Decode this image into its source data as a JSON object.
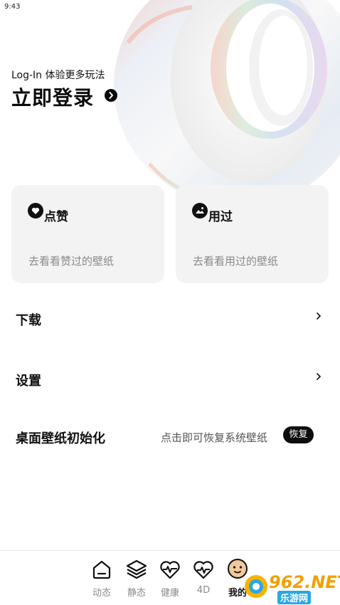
{
  "status_bar": {
    "time": "9:43"
  },
  "login": {
    "subtitle": "Log-In 体验更多玩法",
    "title": "立即登录"
  },
  "cards": [
    {
      "title": "点赞",
      "desc": "去看看赞过的壁纸",
      "icon": "heart-icon"
    },
    {
      "title": "用过",
      "desc": "去看看用过的壁纸",
      "icon": "image-icon"
    }
  ],
  "menu": {
    "download": "下载",
    "settings": "设置",
    "reset": {
      "label": "桌面壁纸初始化",
      "hint": "点击即可恢复系统壁纸",
      "button": "恢复"
    }
  },
  "tabs": [
    {
      "label": "动态",
      "icon": "home-icon"
    },
    {
      "label": "静态",
      "icon": "layers-icon"
    },
    {
      "label": "健康",
      "icon": "heart-pulse-icon"
    },
    {
      "label": "4D",
      "icon": "heart-pulse-outline-icon"
    },
    {
      "label": "我的",
      "icon": "face-icon",
      "active": true
    }
  ],
  "watermark": {
    "text": "962.NET",
    "sub": "乐游网"
  }
}
